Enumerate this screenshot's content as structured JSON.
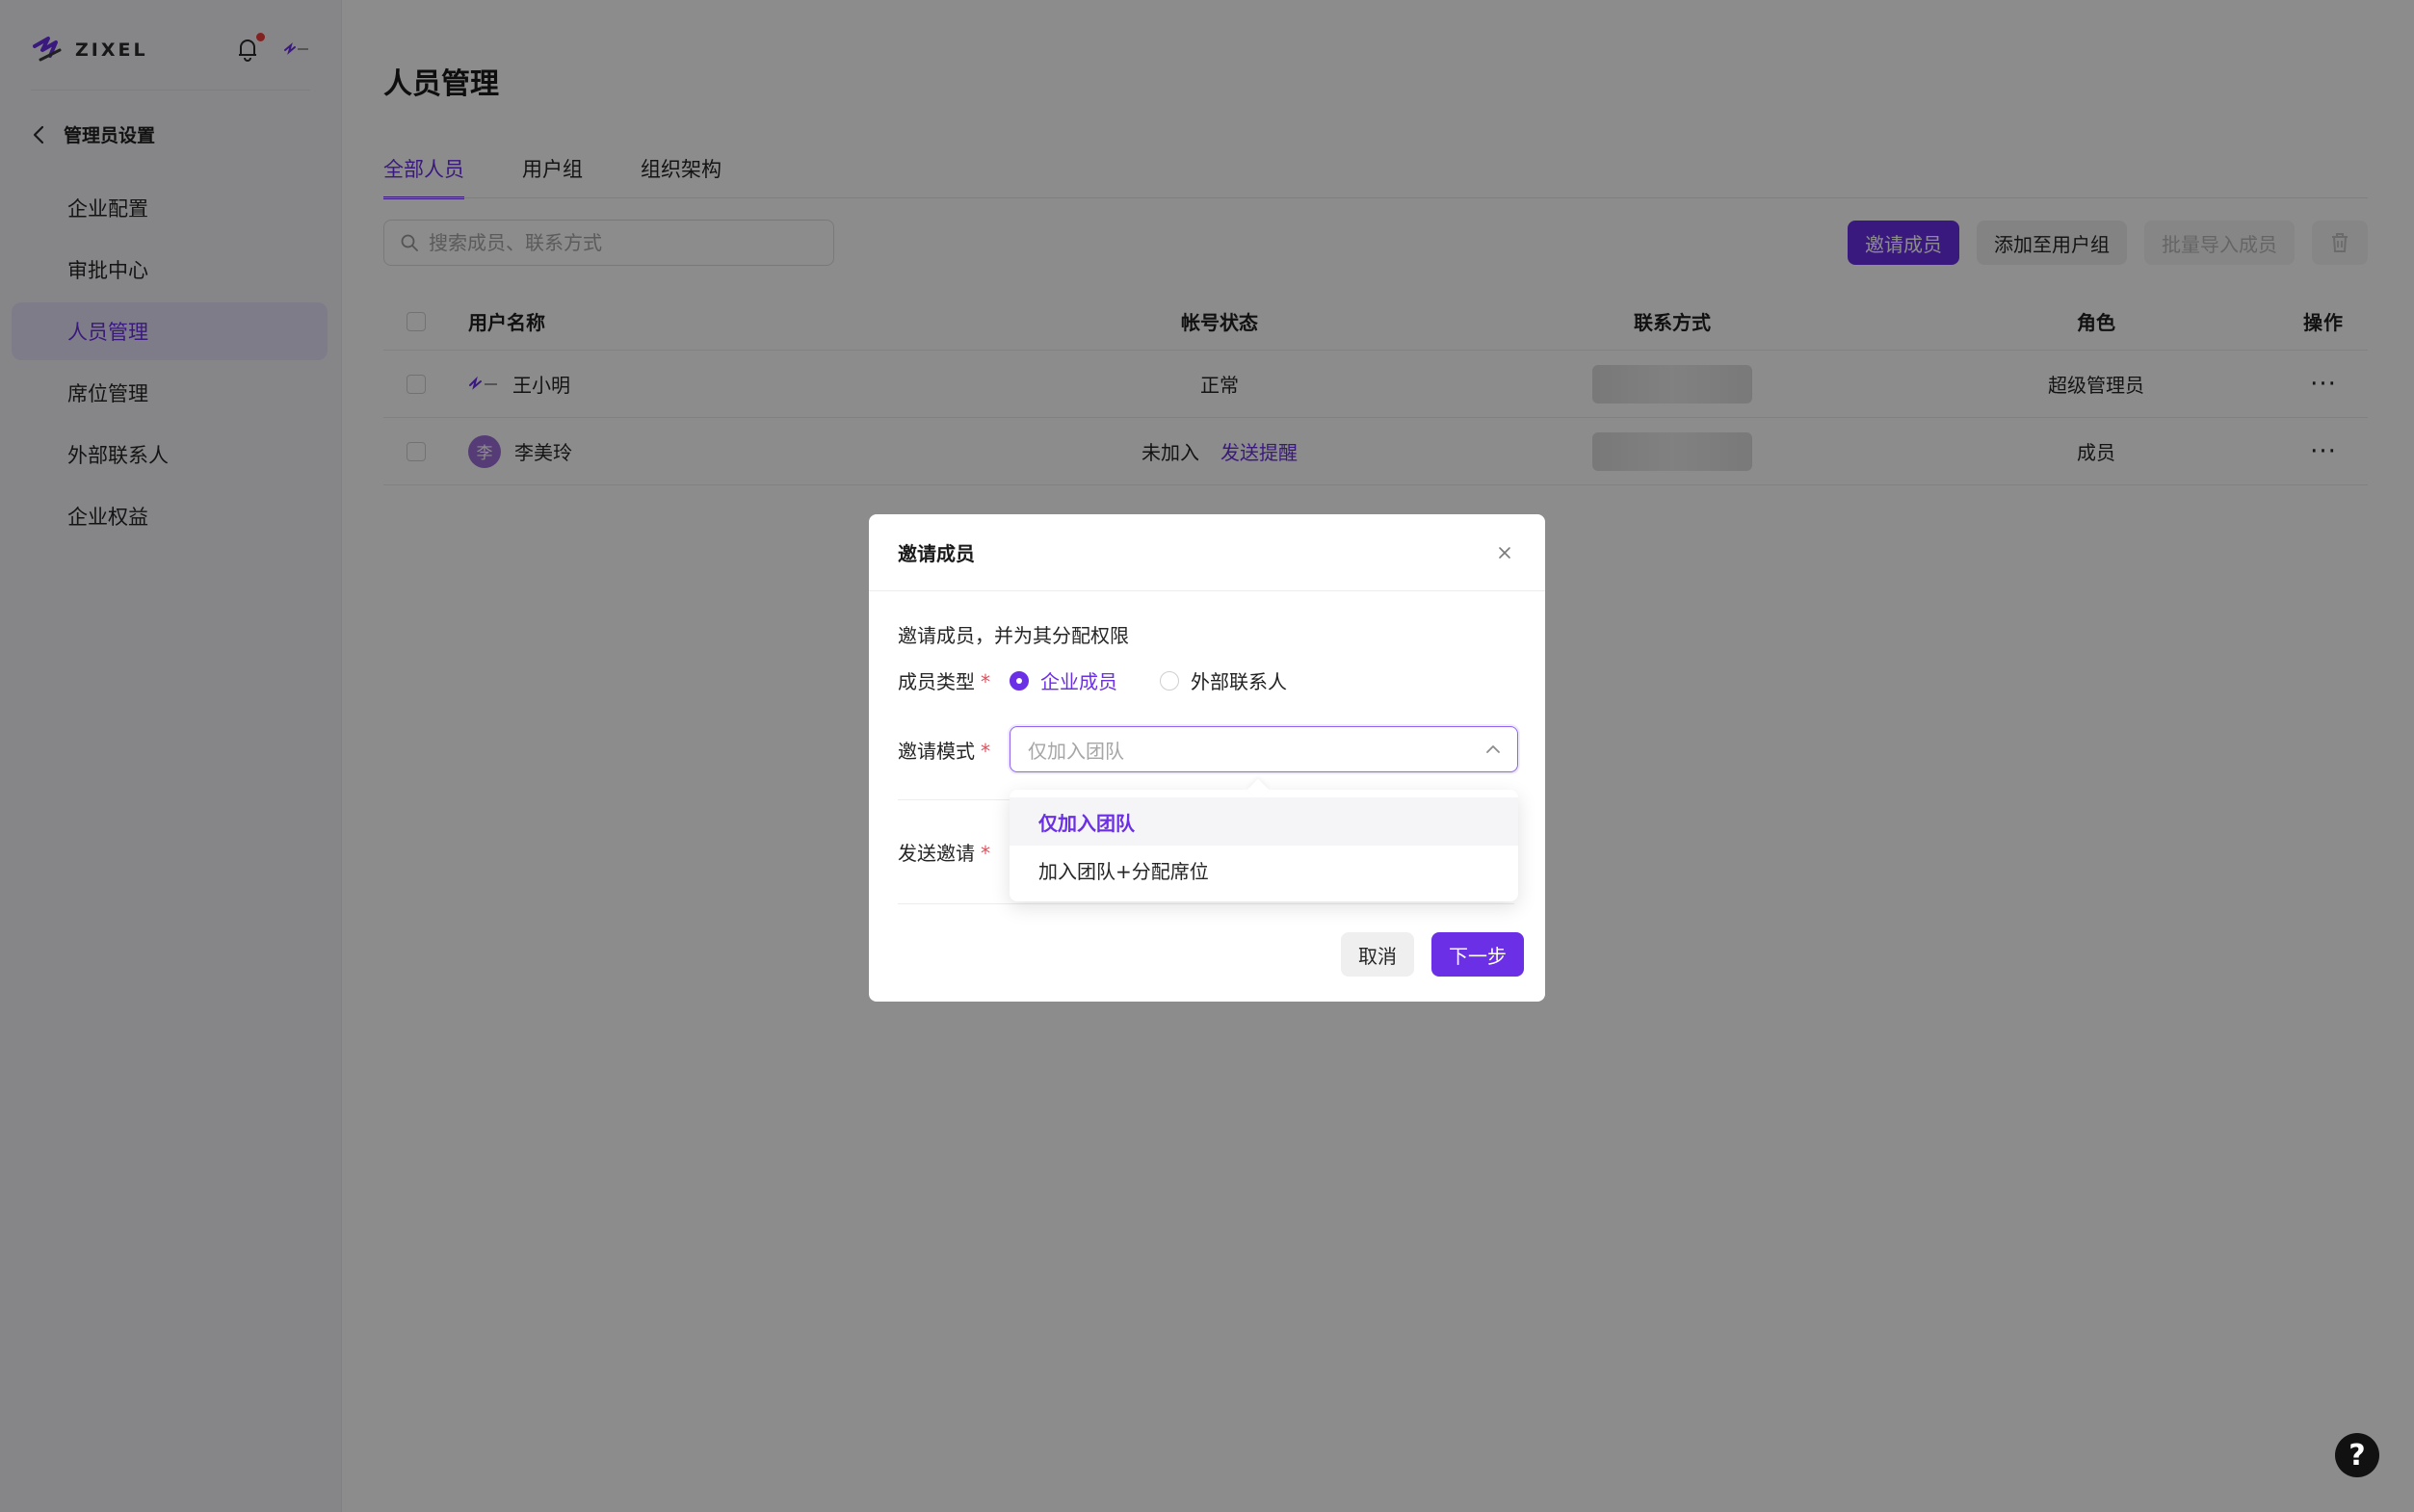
{
  "app": {
    "brand": "ZIXEL"
  },
  "sidebar": {
    "back_label": "管理员设置",
    "items": [
      {
        "label": "企业配置"
      },
      {
        "label": "审批中心"
      },
      {
        "label": "人员管理",
        "active": true
      },
      {
        "label": "席位管理"
      },
      {
        "label": "外部联系人"
      },
      {
        "label": "企业权益"
      }
    ]
  },
  "main": {
    "title": "人员管理",
    "tabs": [
      {
        "label": "全部人员",
        "active": true
      },
      {
        "label": "用户组"
      },
      {
        "label": "组织架构"
      }
    ],
    "search": {
      "placeholder": "搜索成员、联系方式"
    },
    "toolbar": {
      "invite_label": "邀请成员",
      "add_group_label": "添加至用户组",
      "bulk_import_label": "批量导入成员"
    },
    "table": {
      "headers": {
        "name": "用户名称",
        "status": "帐号状态",
        "contact": "联系方式",
        "role": "角色",
        "actions": "操作"
      },
      "rows": [
        {
          "name": "王小明",
          "status": "正常",
          "action_link": "",
          "role": "超级管理员",
          "avatar": "logo",
          "more": "···"
        },
        {
          "name": "李美玲",
          "status": "未加入",
          "action_link": "发送提醒",
          "role": "成员",
          "avatar": "李",
          "more": "···"
        }
      ]
    }
  },
  "modal": {
    "title": "邀请成员",
    "description": "邀请成员，并为其分配权限",
    "member_type": {
      "label": "成员类型",
      "required_mark": "*",
      "options": [
        {
          "label": "企业成员",
          "selected": true
        },
        {
          "label": "外部联系人",
          "selected": false
        }
      ]
    },
    "invite_mode": {
      "label": "邀请模式",
      "required_mark": "*",
      "placeholder": "仅加入团队",
      "options": [
        {
          "label": "仅加入团队",
          "selected": true
        },
        {
          "label": "加入团队+分配席位",
          "selected": false
        }
      ]
    },
    "send_invite": {
      "label": "发送邀请",
      "required_mark": "*"
    },
    "cancel_label": "取消",
    "next_label": "下一步"
  },
  "help": {
    "label": "?"
  },
  "colors": {
    "accent": "#6b2fe6",
    "required": "#e34d59",
    "notification_dot": "#ef3b3b"
  },
  "icons": [
    "logo-icon",
    "bell-icon",
    "chevron-left-icon",
    "search-icon",
    "trash-icon",
    "close-icon",
    "chevron-up-icon",
    "help-icon"
  ]
}
